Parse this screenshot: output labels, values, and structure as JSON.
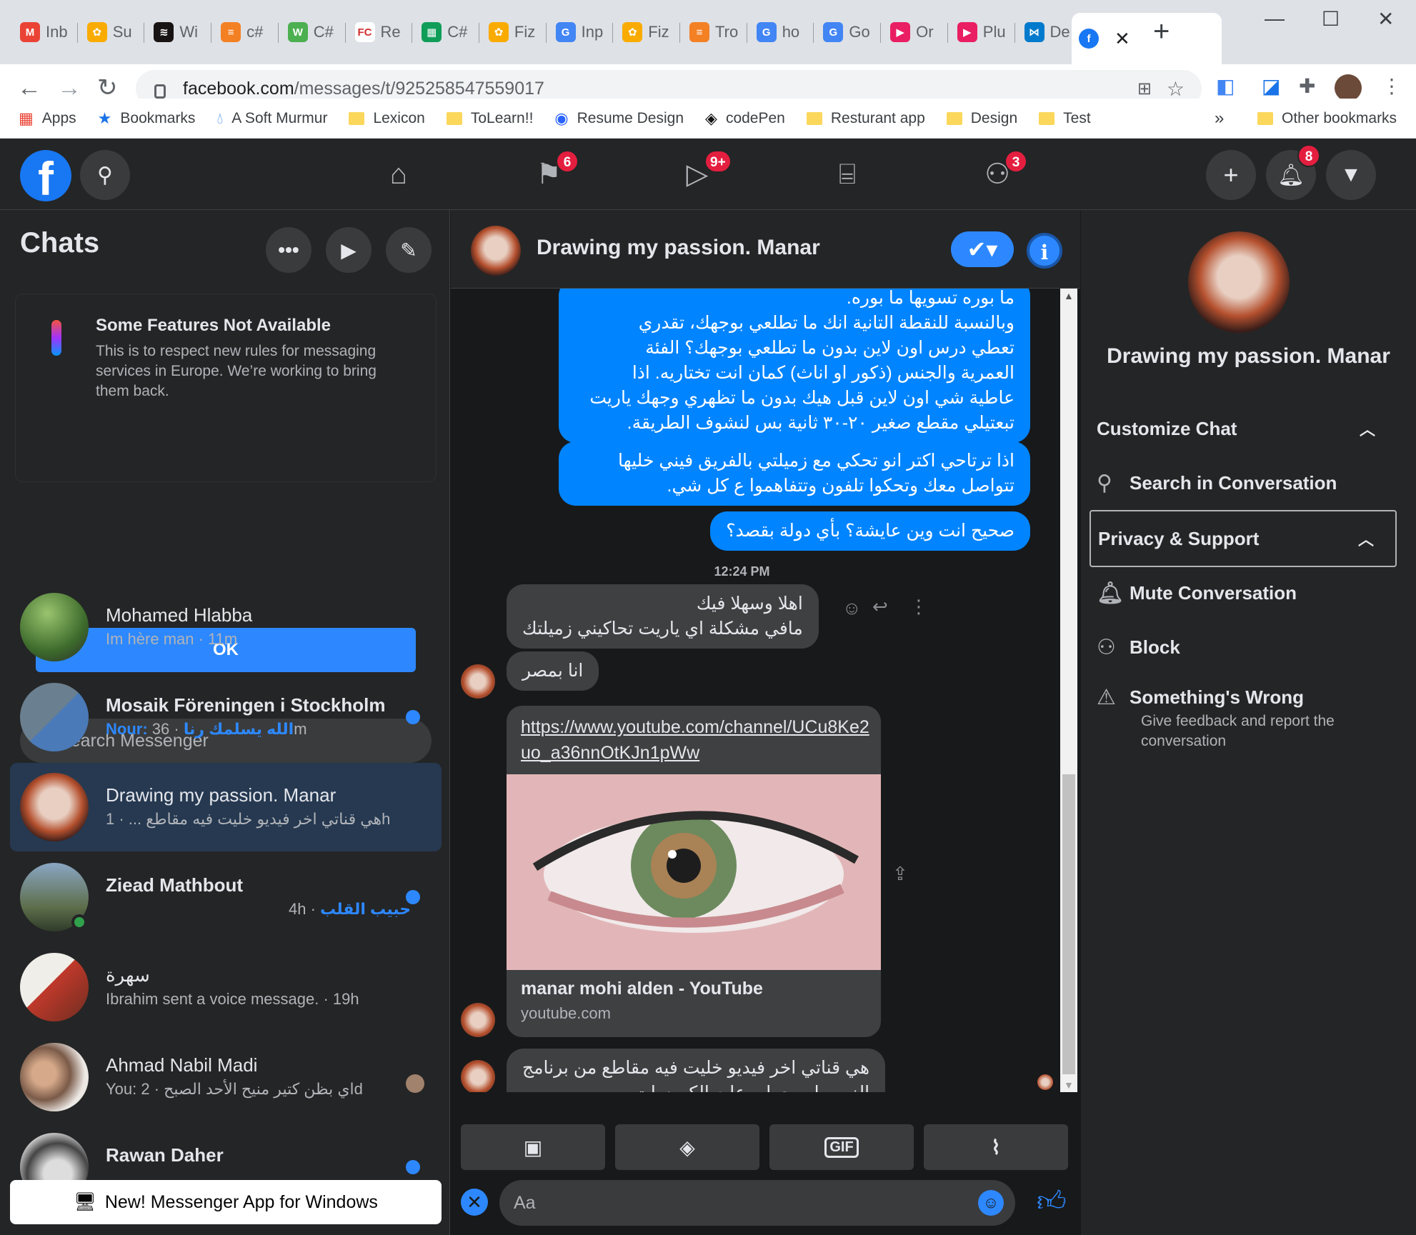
{
  "browser": {
    "tabs": [
      {
        "label": "Inb",
        "color": "#ea4335",
        "glyph": "M"
      },
      {
        "label": "Su",
        "color": "#f9ab00",
        "glyph": "✿"
      },
      {
        "label": "Wi",
        "color": "#191414",
        "glyph": "≋"
      },
      {
        "label": "c#",
        "color": "#f48024",
        "glyph": "≡"
      },
      {
        "label": "C#",
        "color": "#4caf50",
        "glyph": "W"
      },
      {
        "label": "Re",
        "color": "#ffffff",
        "glyph": "FC"
      },
      {
        "label": "C#",
        "color": "#0f9d58",
        "glyph": "▦"
      },
      {
        "label": "Fiz",
        "color": "#f9ab00",
        "glyph": "✿"
      },
      {
        "label": "Inp",
        "color": "#4285f4",
        "glyph": "G"
      },
      {
        "label": "Fiz",
        "color": "#f9ab00",
        "glyph": "✿"
      },
      {
        "label": "Tro",
        "color": "#f48024",
        "glyph": "≡"
      },
      {
        "label": "ho",
        "color": "#4285f4",
        "glyph": "G"
      },
      {
        "label": "Go",
        "color": "#4285f4",
        "glyph": "G"
      },
      {
        "label": "Or",
        "color": "#e91e63",
        "glyph": "▶"
      },
      {
        "label": "Plu",
        "color": "#e91e63",
        "glyph": "▶"
      },
      {
        "label": "De",
        "color": "#007acc",
        "glyph": "⋈"
      }
    ],
    "active_tab_close": "✕",
    "new_tab": "+",
    "url_host": "facebook.com",
    "url_path": "/messages/t/925258547559017",
    "bookmarks": [
      {
        "label": "Apps",
        "type": "apps"
      },
      {
        "label": "Bookmarks",
        "type": "star"
      },
      {
        "label": "A Soft Murmur",
        "type": "drop"
      },
      {
        "label": "Lexicon",
        "type": "folder"
      },
      {
        "label": "ToLearn!!",
        "type": "folder"
      },
      {
        "label": "Resume Design",
        "type": "globe"
      },
      {
        "label": "codePen",
        "type": "codepen"
      },
      {
        "label": "Resturant app",
        "type": "folder"
      },
      {
        "label": "Design",
        "type": "folder"
      },
      {
        "label": "Test",
        "type": "folder"
      }
    ],
    "more_bookmarks": "»",
    "other_bookmarks": "Other bookmarks"
  },
  "fb": {
    "logo": "f",
    "badges": {
      "pages": "6",
      "watch": "9+",
      "groups": "3",
      "notifications": "8"
    }
  },
  "sidebar": {
    "title": "Chats",
    "notice_title": "Some Features Not Available",
    "notice_body": "This is to respect new rules for messaging services in Europe. We’re working to bring them back.",
    "notice_ok": "OK",
    "search_placeholder": "Search Messenger",
    "conversations": [
      {
        "name": "Mohamed Hlabba",
        "preview": "Im hère man · 11m",
        "unread": false
      },
      {
        "name": "Mosaik Föreningen i Stockholm",
        "sender": "Nour: الله يسلمك رنا",
        "time": " · 36m",
        "unread": true
      },
      {
        "name": "Drawing my passion. Manar",
        "preview": "هي قناتي اخر فيديو خليت فيه مقاطع ... · 1h",
        "unread": false
      },
      {
        "name": "Ziead Mathbout",
        "time": "4h · ",
        "sender": "حبيب القلب",
        "unread": true
      },
      {
        "name": "سهرة",
        "preview": "Ibrahim sent a voice message. · 19h",
        "unread": false
      },
      {
        "name": "Ahmad Nabil Madi",
        "preview": "You: اي بظن كتير منيح الأحد الصبح · 2d",
        "unread": false
      },
      {
        "name": "Rawan Daher",
        "preview": "",
        "unread": true
      }
    ],
    "new_app": "New! Messenger App for Windows"
  },
  "chat": {
    "title": "Drawing my passion. Manar",
    "outgoing": [
      {
        "text": "ما بوره تسويها ما بوره.\nوبالنسبة للنقطة التانية انك ما تطلعي بوجهك، تقدري\nتعطي درس اون لاين بدون ما تطلعي بوجهك؟ الفئة\nالعمرية والجنس (ذكور او اناث) كمان انت تختاريه. اذا\nعاطية شي اون لاين قبل هيك بدون ما تظهري وجهك ياريت\nتبعتيلي مقطع صغير ٢٠-٣٠ ثانية بس لنشوف الطريقة."
      },
      {
        "text": "اذا ترتاحي اكتر انو تحكي مع زميلتي بالفريق فيني خليها\nتتواصل معك وتحكوا تلفون وتتفاهموا ع كل شي."
      },
      {
        "text": "صحيح انت وين عايشة؟ بأي دولة بقصد؟"
      }
    ],
    "timestamp": "12:24 PM",
    "incoming": [
      {
        "text": "اهلا وسهلا فيك\nمافي مشكلة اي ياريت  تحاكيني زميلتك"
      },
      {
        "text": "انا بمصر"
      },
      {
        "text": "هي قناتي اخر فيديو خليت فيه مقاطع من برنامج\nالزوم يلي بعطي عليه الكورسات"
      }
    ],
    "link": {
      "url": "https://www.youtube.com/channel/UCu8Ke2uo_a36nnOtKJn1pWw",
      "title": "manar mohi alden - YouTube",
      "domain": "youtube.com"
    },
    "composer_placeholder": "Aa"
  },
  "details": {
    "name": "Drawing my passion. Manar",
    "customize": "Customize Chat",
    "search": "Search in Conversation",
    "privacy": "Privacy & Support",
    "mute": "Mute Conversation",
    "block": "Block",
    "wrong": "Something's Wrong",
    "wrong_sub": "Give feedback and report the conversation"
  },
  "colors": {
    "accent": "#2d88ff",
    "bubble_out": "#0084ff",
    "bg": "#18191a",
    "panel": "#242526",
    "badge": "#e41e3f"
  }
}
